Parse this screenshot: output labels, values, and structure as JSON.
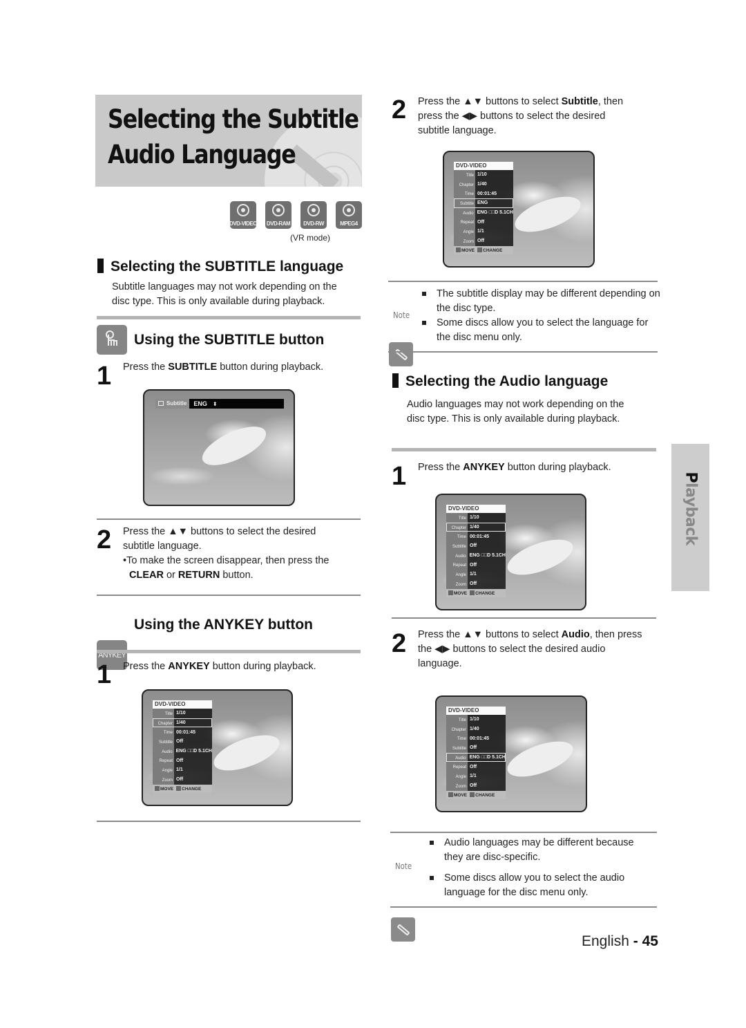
{
  "title": {
    "line1": "Selecting the Subtitle &",
    "line2": "Audio Language"
  },
  "disc_types": [
    {
      "icon": "dvd-video-disc-icon",
      "label": "DVD-VIDEO"
    },
    {
      "icon": "dvd-ram-disc-icon",
      "label": "DVD-RAM"
    },
    {
      "icon": "dvd-rw-disc-icon",
      "label": "DVD-RW"
    },
    {
      "icon": "mpeg4-disc-icon",
      "label": "MPEG4"
    }
  ],
  "vr_mode": "(VR mode)",
  "subtitle_section": {
    "heading": "Selecting the SUBTITLE language",
    "description_line1": "Subtitle languages may not work depending on the",
    "description_line2": "disc type. This is only available during playback.",
    "subtitle_button": {
      "heading": "Using the SUBTITLE button",
      "icon": "hand-press-icon",
      "step1": {
        "num": "1",
        "pre": "Press the ",
        "bold": "SUBTITLE",
        "post": " button during playback."
      },
      "osd": {
        "label": "Subtitle",
        "value": "ENG",
        "arrows": "⬍"
      },
      "step2": {
        "num": "2",
        "line1": "Press the ▲▼ buttons to select the desired",
        "line2": "subtitle language.",
        "bullet_pre": "•To make the screen disappear, then press the",
        "bullet_b1": "CLEAR",
        "bullet_mid": " or ",
        "bullet_b2": "RETURN",
        "bullet_post": " button."
      }
    },
    "anykey_button": {
      "heading": "Using the ANYKEY button",
      "icon_label": "ANYKEY",
      "step1": {
        "num": "1",
        "pre": "Press the ",
        "bold": "ANYKEY",
        "post": " button during playback."
      }
    },
    "step2": {
      "num": "2",
      "pre": "Press the ▲▼ buttons to select ",
      "bold": "Subtitle",
      "post1": ", then",
      "line2": "press the ◀▶ buttons to select the desired",
      "line3": "subtitle language."
    },
    "note": {
      "label": "Note",
      "items": [
        "The subtitle display may be different depending on the disc type.",
        "Some discs allow you to select the language for the disc menu only."
      ]
    }
  },
  "audio_section": {
    "heading": "Selecting the Audio language",
    "description_line1": "Audio languages may not work depending on the",
    "description_line2": "disc type. This is only available during playback.",
    "step1": {
      "num": "1",
      "pre": "Press the ",
      "bold": "ANYKEY",
      "post": " button during playback."
    },
    "step2": {
      "num": "2",
      "pre": "Press the ▲▼ buttons to select ",
      "bold": "Audio",
      "post1": ", then press",
      "line2": "the ◀▶ buttons to select the desired audio",
      "line3": "language."
    },
    "note": {
      "label": "Note",
      "items": [
        "Audio languages may be different because they are disc-specific.",
        "Some discs allow you to select the audio language for the disc menu only."
      ]
    }
  },
  "osd_menus": {
    "anykey_left": {
      "header": "DVD-VIDEO",
      "selected": "Chapter",
      "rows": [
        {
          "key": "Title",
          "value": "1/10"
        },
        {
          "key": "Chapter",
          "value": "1/40"
        },
        {
          "key": "Time",
          "value": "00:01:45"
        },
        {
          "key": "Subtitle",
          "value": "Off"
        },
        {
          "key": "Audio",
          "value": "ENG □□D 5.1CH"
        },
        {
          "key": "Repeat",
          "value": "Off"
        },
        {
          "key": "Angle",
          "value": "1/1"
        },
        {
          "key": "Zoom",
          "value": "Off"
        }
      ],
      "footer_move": "MOVE",
      "footer_change": "CHANGE"
    },
    "subtitle_selected": {
      "header": "DVD-VIDEO",
      "selected": "Subtitle",
      "rows": [
        {
          "key": "Title",
          "value": "1/10"
        },
        {
          "key": "Chapter",
          "value": "1/40"
        },
        {
          "key": "Time",
          "value": "00:01:45"
        },
        {
          "key": "Subtitle",
          "value": "ENG"
        },
        {
          "key": "Audio",
          "value": "ENG □□D 5.1CH"
        },
        {
          "key": "Repeat",
          "value": "Off"
        },
        {
          "key": "Angle",
          "value": "1/1"
        },
        {
          "key": "Zoom",
          "value": "Off"
        }
      ],
      "footer_move": "MOVE",
      "footer_change": "CHANGE"
    },
    "anykey_right": {
      "header": "DVD-VIDEO",
      "selected": "Chapter",
      "rows": [
        {
          "key": "Title",
          "value": "1/10"
        },
        {
          "key": "Chapter",
          "value": "1/40"
        },
        {
          "key": "Time",
          "value": "00:01:45"
        },
        {
          "key": "Subtitle",
          "value": "Off"
        },
        {
          "key": "Audio",
          "value": "ENG □□D 5.1CH"
        },
        {
          "key": "Repeat",
          "value": "Off"
        },
        {
          "key": "Angle",
          "value": "1/1"
        },
        {
          "key": "Zoom",
          "value": "Off"
        }
      ],
      "footer_move": "MOVE",
      "footer_change": "CHANGE"
    },
    "audio_selected": {
      "header": "DVD-VIDEO",
      "selected": "Audio",
      "rows": [
        {
          "key": "Title",
          "value": "1/10"
        },
        {
          "key": "Chapter",
          "value": "1/40"
        },
        {
          "key": "Time",
          "value": "00:01:45"
        },
        {
          "key": "Subtitle",
          "value": "Off"
        },
        {
          "key": "Audio",
          "value": "ENG □□D 5.1CH"
        },
        {
          "key": "Repeat",
          "value": "Off"
        },
        {
          "key": "Angle",
          "value": "1/1"
        },
        {
          "key": "Zoom",
          "value": "Off"
        }
      ],
      "footer_move": "MOVE",
      "footer_change": "CHANGE"
    }
  },
  "side_tab": {
    "first": "P",
    "rest": "layback"
  },
  "footer": {
    "language": "English",
    "sep": " - ",
    "page": "45"
  }
}
